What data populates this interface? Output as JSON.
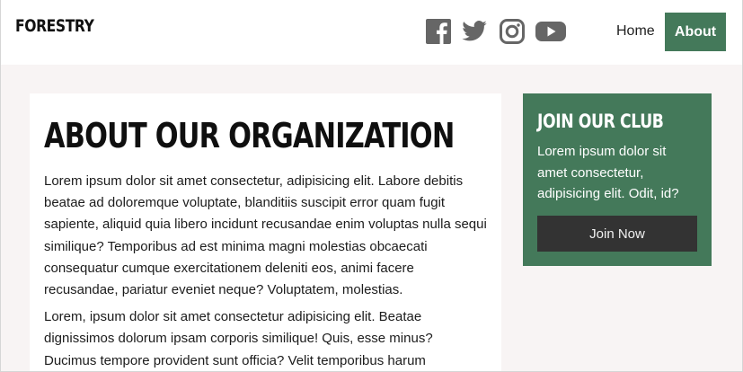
{
  "header": {
    "logo": "FORESTRY",
    "social_icons": [
      "facebook-icon",
      "twitter-icon",
      "instagram-icon",
      "youtube-icon"
    ],
    "nav": {
      "home": "Home",
      "about": "About"
    }
  },
  "article": {
    "title": "ABOUT OUR ORGANIZATION",
    "paragraphs": [
      "Lorem ipsum dolor sit amet consectetur, adipisicing elit. Labore debitis beatae ad doloremque voluptate, blanditiis suscipit error quam fugit sapiente, aliquid quia libero incidunt recusandae enim voluptas nulla sequi similique? Temporibus ad est minima magni molestias obcaecati consequatur cumque exercitationem deleniti eos, animi facere recusandae, pariatur eveniet neque? Voluptatem, molestias.",
      "Lorem, ipsum dolor sit amet consectetur adipisicing elit. Beatae dignissimos dolorum ipsam corporis similique! Quis, esse minus? Ducimus tempore provident sunt officia? Velit temporibus harum"
    ]
  },
  "sidebar": {
    "title": "JOIN OUR CLUB",
    "text": "Lorem ipsum dolor sit amet consectetur, adipisicing elit. Odit, id?",
    "button": "Join Now"
  },
  "colors": {
    "accent_green": "#44795a",
    "page_background": "#f8f4f4",
    "button_dark": "#333333",
    "icon_gray": "#666666"
  }
}
